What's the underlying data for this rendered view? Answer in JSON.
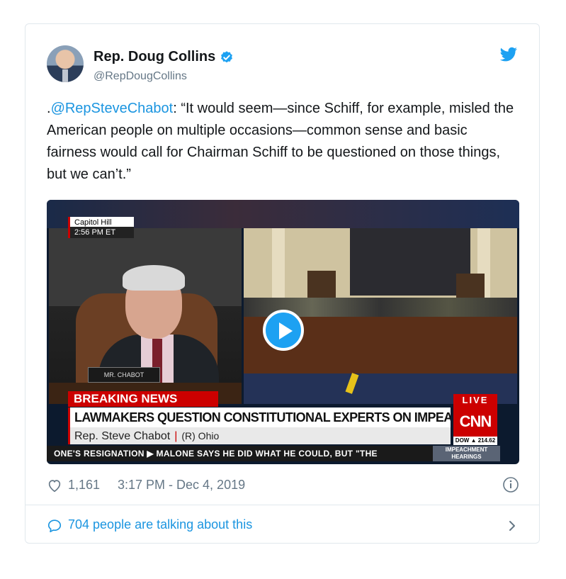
{
  "tweet": {
    "author_name": "Rep. Doug Collins",
    "handle": "@RepDougCollins",
    "mention": "@RepSteveChabot",
    "text_prefix": ".",
    "text_body": ": “It would seem—since Schiff, for example, misled the American people on multiple occasions—common sense and basic fairness would call for Chairman Schiff to be questioned on those things, but we can’t.”",
    "likes": "1,161",
    "timestamp": "3:17 PM - Dec 4, 2019",
    "talking": "704 people are talking about this"
  },
  "video": {
    "location": "Capitol Hill",
    "time": "2:56 PM ET",
    "nameplate": "MR. CHABOT",
    "breaking": "BREAKING NEWS",
    "headline": "LAWMAKERS QUESTION CONSTITUTIONAL EXPERTS ON IMPEACHMENT",
    "speaker": "Rep. Steve Chabot",
    "party": "(R) Ohio",
    "ticker": "ONE'S RESIGNATION   ▶  MALONE SAYS HE DID WHAT HE COULD, BUT \"THE",
    "live": "LIVE",
    "network": "CNN",
    "dow": "DOW ▲ 214.62",
    "impeachment_label": "IMPEACHMENT HEARINGS"
  },
  "colors": {
    "accent": "#1da1f2",
    "link": "#1b95e0",
    "muted": "#657786",
    "cnn_red": "#cc0000"
  },
  "icons": [
    "verified-badge-icon",
    "twitter-bird-icon",
    "play-icon",
    "heart-icon",
    "info-icon",
    "comment-bubble-icon",
    "chevron-right-icon"
  ]
}
